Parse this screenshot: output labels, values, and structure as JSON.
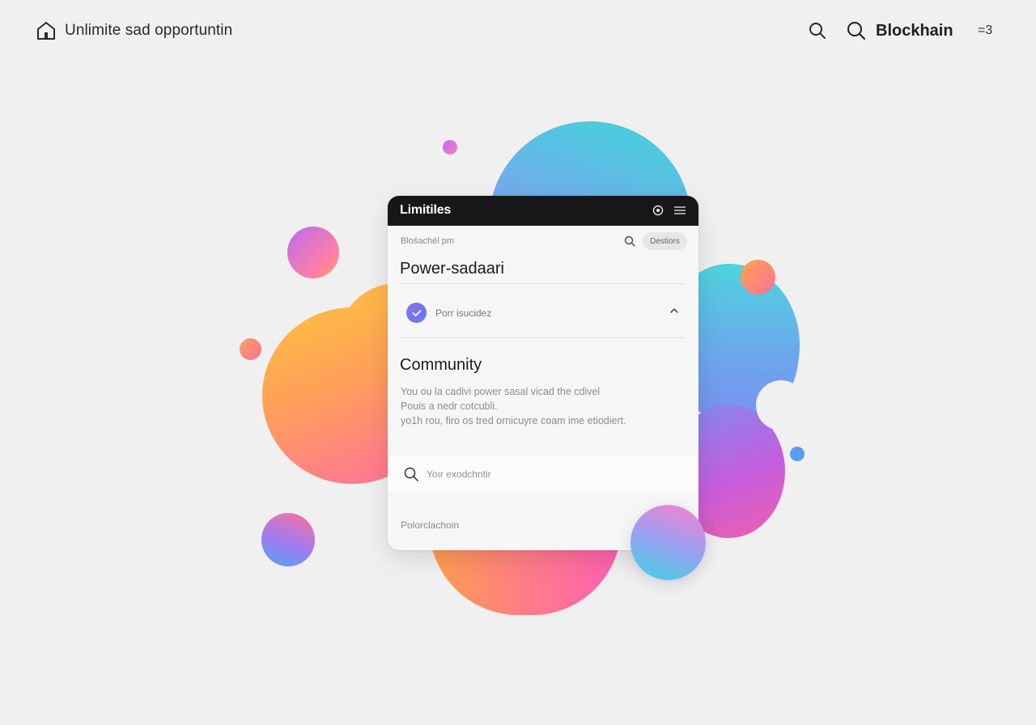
{
  "topbar": {
    "brand_title": "Unlimite sad opportuntin",
    "nav_label": "Blockhain",
    "menu_label": "=3"
  },
  "card": {
    "title": "Limitiles",
    "breadcrumb": "Blośachél pm",
    "chip_label": "Destiors",
    "heading": "Power-sadaari",
    "accordion_label": "Porr isucidez",
    "section_title": "Community",
    "paragraph_lines": [
      "You ou la cadivi power sasal vicad the cdivel",
      "Pouis a nedr cotcubli.",
      "yo1h rou, firo os tred ornicuyre coam ime etiodiert."
    ],
    "search_placeholder": "Yoır exodchntir",
    "footer_text": "Polorclachoin"
  },
  "colors": {
    "background": "#f0f0f0",
    "card_header": "#17171a",
    "accent_badge": "#7a74f0"
  },
  "icons": [
    "home-icon",
    "search-icon",
    "settings-icon",
    "menu-icon",
    "check-icon",
    "chevron-up-icon"
  ]
}
